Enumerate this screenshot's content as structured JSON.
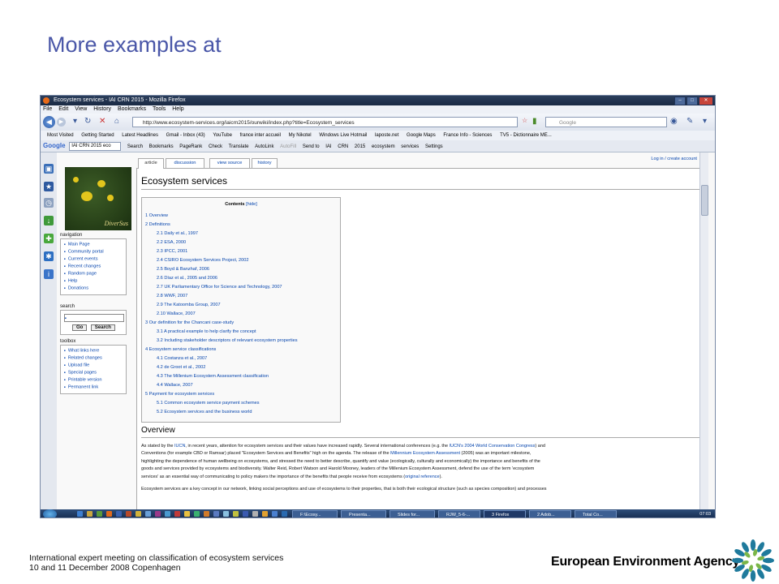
{
  "slide": {
    "title": "More examples at",
    "footer_line1": "International expert meeting on classification of ecosystem services",
    "footer_line2": "10 and 11 December 2008 Copenhagen",
    "agency": "European Environment Agency"
  },
  "browser": {
    "window_title": "Ecosystem services - IAI CRN 2015 - Mozilla Firefox",
    "menu": [
      "File",
      "Edit",
      "View",
      "History",
      "Bookmarks",
      "Tools",
      "Help"
    ],
    "url": "http://www.ecosystem-services.org/iaicrn2015/ourwiki/index.php?title=Ecosystem_services",
    "search_placeholder": "Google",
    "bookmarks": [
      "Most Visited",
      "Getting Started",
      "Latest Headlines",
      "Gmail - Inbox (43)",
      "YouTube",
      "france inter accueil",
      "My Nikotel",
      "Windows Live Hotmail",
      "laposte.net",
      "Google Maps",
      "France Info - Sciences",
      "TV5 - Dictionnaire ME..."
    ],
    "google_toolbar": {
      "logo": "Google",
      "box": "IAI CRN 2015 eco",
      "items": [
        "Search",
        "Bookmarks",
        "PageRank",
        "Check",
        "Translate",
        "AutoLink",
        "AutoFill",
        "Send to",
        "IAI",
        "CRN",
        "2015",
        "ecosystem",
        "services",
        "Settings"
      ]
    }
  },
  "wiki": {
    "tabs": [
      "article",
      "discussion",
      "view source",
      "history"
    ],
    "login": "Log in / create account",
    "page_title": "Ecosystem services",
    "logo_text": "DiverSus",
    "navigation": {
      "heading": "navigation",
      "items": [
        "Main Page",
        "Community portal",
        "Current events",
        "Recent changes",
        "Random page",
        "Help",
        "Donations"
      ]
    },
    "search": {
      "heading": "search",
      "go": "Go",
      "search": "Search"
    },
    "toolbox": {
      "heading": "toolbox",
      "items": [
        "What links here",
        "Related changes",
        "Upload file",
        "Special pages",
        "Printable version",
        "Permanent link"
      ]
    },
    "toc": {
      "title": "Contents",
      "hide": "[hide]",
      "items": [
        "1 Overview",
        "2 Definitions",
        "2.1 Daily et al., 1997",
        "2.2 ESA, 2000",
        "2.3 IPCC, 2001",
        "2.4 CSIRO Ecosystem Services Project, 2002",
        "2.5 Boyd & Banzhaf, 2006",
        "2.6 Díaz et al., 2005 and 2006",
        "2.7 UK Parliamentary Office for Science and Technology, 2007",
        "2.8 WWF, 2007",
        "2.9 The Katoomba Group, 2007",
        "2.10 Wallace, 2007",
        "3 Our definition for the Chancani case-study",
        "3.1 A practical example to help clarify the concept",
        "3.2 Including stakeholder descriptors of relevant ecosystem properties",
        "4 Ecosystem service classifications",
        "4.1 Costanza et al., 2007",
        "4.2 de Groot et al., 2002",
        "4.3 The Millenium Ecosystem Assessment classification",
        "4.4 Wallace, 2007",
        "5 Payment for ecosystem services",
        "5.1 Common ecosystem service payment schemes",
        "5.2 Ecosystem services and the business world"
      ]
    },
    "overview_heading": "Overview",
    "para1": {
      "a": "As stated by the ",
      "link1": "IUCN",
      "b": ", in recent years, attention for ecosystem services and their values have increased rapidly. Several international conferences (e.g. the ",
      "link2": "IUCN's 2004 World Conservation Congress",
      "c": ") and",
      "line2a": "Conventions (for example CBD or Ramsar) placed \"Ecosystem Services and Benefits\" high on the agenda. The release of the ",
      "link3": "Millennium Ecosystem Assessment",
      "line2b": " (2005) was an important milestone,",
      "line3": "highlighting the dependence of human wellbeing on ecosystems, and stressed the need to better describe, quantify and value (ecologically, culturally and economically) the importance and benefits of the",
      "line4": "goods and services provided by ecosystems and biodiversity. Walter Reid, Robert Watson and Harold Mooney, leaders of the Millenium Ecosystem Assessment, defend the use of the term 'ecosystem",
      "line5a": "services' as an essential way of communicating to policy makers the importance of the benefits that people receive from ecosystems (",
      "link4": "original reference",
      "line5b": ")."
    },
    "para2": "Ecosystem services are a key concept in our network, linking social perceptions and use of ecosystems to their properties, that is both their ecological structure (such as species composition) and processes"
  },
  "taskbar": {
    "items": [
      "F:\\Ecosy...",
      "Presenta...",
      "Slides for...",
      "RJW_5-6-...",
      "3 Firefox",
      "2 Adob...",
      "Total Co..."
    ],
    "clock": "07:03"
  }
}
